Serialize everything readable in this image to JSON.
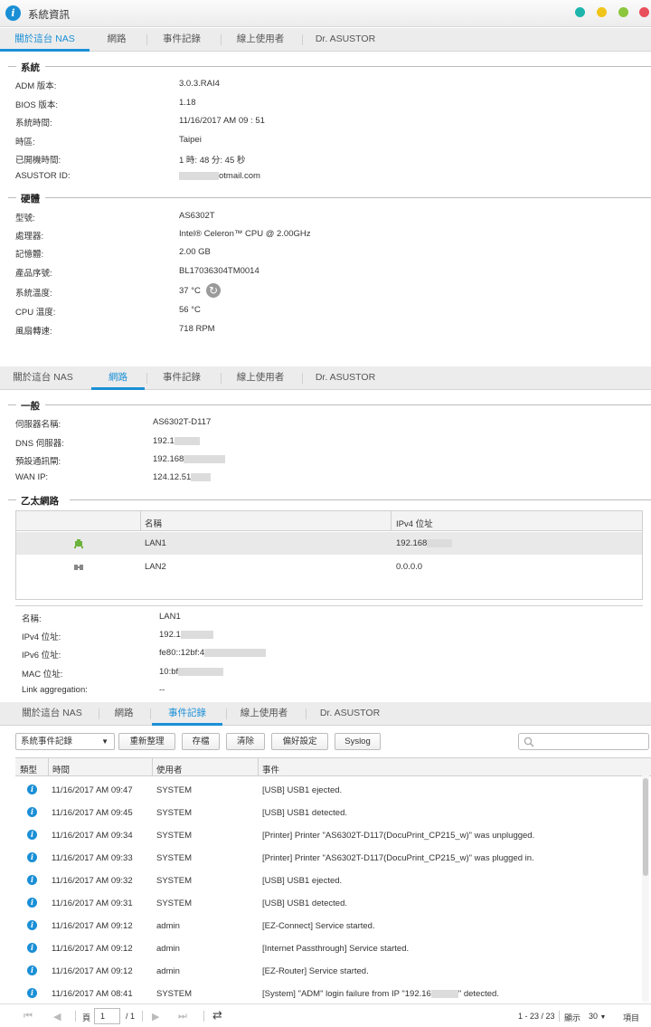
{
  "window": {
    "title": "系統資訊"
  },
  "tabs": [
    "關於這台 NAS",
    "網路",
    "事件記錄",
    "線上使用者",
    "Dr. ASUSTOR"
  ],
  "system": {
    "title": "系統",
    "rows": [
      {
        "label": "ADM 版本:",
        "value": "3.0.3.RAI4"
      },
      {
        "label": "BIOS 版本:",
        "value": "1.18"
      },
      {
        "label": "系統時間:",
        "value": "11/16/2017  AM 09 : 51"
      },
      {
        "label": "時區:",
        "value": "Taipei"
      },
      {
        "label": "已開機時間:",
        "value": "1 時: 48 分: 45 秒"
      },
      {
        "label": "ASUSTOR ID:",
        "value": "otmail.com"
      }
    ]
  },
  "hardware": {
    "title": "硬體",
    "rows": [
      {
        "label": "型號:",
        "value": "AS6302T"
      },
      {
        "label": "處理器:",
        "value": "Intel® Celeron™ CPU @ 2.00GHz"
      },
      {
        "label": "記憶體:",
        "value": "2.00 GB"
      },
      {
        "label": "產品序號:",
        "value": "BL17036304TM0014"
      },
      {
        "label": "系統溫度:",
        "value": "37 °C"
      },
      {
        "label": "CPU 溫度:",
        "value": "56 °C"
      },
      {
        "label": "風扇轉速:",
        "value": "718 RPM"
      }
    ]
  },
  "general": {
    "title": "一般",
    "rows": [
      {
        "label": "伺服器名稱:",
        "value": "AS6302T-D117"
      },
      {
        "label": "DNS 伺服器:",
        "value": "192.1"
      },
      {
        "label": "預設通訊閘:",
        "value": "192.168"
      },
      {
        "label": "WAN IP:",
        "value": "124.12.51"
      }
    ]
  },
  "ethernet": {
    "title": "乙太網路",
    "columns": [
      "名稱",
      "IPv4 位址"
    ],
    "rows": [
      {
        "name": "LAN1",
        "ipv4": "192.168"
      },
      {
        "name": "LAN2",
        "ipv4": "0.0.0.0"
      }
    ],
    "details": [
      {
        "label": "名稱:",
        "value": "LAN1"
      },
      {
        "label": "IPv4 位址:",
        "value": "192.1"
      },
      {
        "label": "IPv6 位址:",
        "value": "fe80::12bf:4"
      },
      {
        "label": "MAC 位址:",
        "value": "10:bf"
      },
      {
        "label": "Link aggregation:",
        "value": "--"
      }
    ]
  },
  "eventlog": {
    "filter": "系統事件記錄",
    "buttons": [
      "重新整理",
      "存檔",
      "清除",
      "偏好設定",
      "Syslog"
    ],
    "columns": [
      "類型",
      "時間",
      "使用者",
      "事件"
    ],
    "rows": [
      {
        "time": "11/16/2017 AM 09:47",
        "user": "SYSTEM",
        "event": "[USB] USB1 ejected."
      },
      {
        "time": "11/16/2017 AM 09:45",
        "user": "SYSTEM",
        "event": "[USB] USB1 detected."
      },
      {
        "time": "11/16/2017 AM 09:34",
        "user": "SYSTEM",
        "event": "[Printer] Printer \"AS6302T-D117(DocuPrint_CP215_w)\" was unplugged."
      },
      {
        "time": "11/16/2017 AM 09:33",
        "user": "SYSTEM",
        "event": "[Printer] Printer \"AS6302T-D117(DocuPrint_CP215_w)\" was plugged in."
      },
      {
        "time": "11/16/2017 AM 09:32",
        "user": "SYSTEM",
        "event": "[USB] USB1 ejected."
      },
      {
        "time": "11/16/2017 AM 09:31",
        "user": "SYSTEM",
        "event": "[USB] USB1 detected."
      },
      {
        "time": "11/16/2017 AM 09:12",
        "user": "admin",
        "event": "[EZ-Connect] Service started."
      },
      {
        "time": "11/16/2017 AM 09:12",
        "user": "admin",
        "event": "[Internet Passthrough] Service started."
      },
      {
        "time": "11/16/2017 AM 09:12",
        "user": "admin",
        "event": "[EZ-Router] Service started."
      },
      {
        "time": "11/16/2017 AM 08:41",
        "user": "SYSTEM",
        "event": "[System] \"ADM\" login failure from IP \"192.16"
      }
    ],
    "last_event_suffix": "\" detected."
  },
  "pager": {
    "page_label": "頁",
    "page": "1",
    "total_pages": "/ 1",
    "range": "1 - 23 / 23",
    "show_label": "顯示",
    "per_page": "30",
    "items_label": "項目"
  },
  "colors": {
    "accent": "#1a8fd6",
    "dot1": "#1fb5ad",
    "dot2": "#f0c419",
    "dot3": "#8cc63e",
    "dot4": "#e8505b"
  }
}
